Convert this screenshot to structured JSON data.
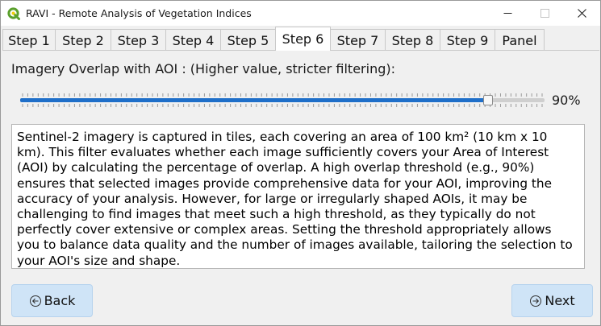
{
  "window": {
    "title": "RAVI - Remote Analysis of Vegetation Indices",
    "brand_color": "#5aa02c"
  },
  "tabs": [
    {
      "label": "Step 1",
      "active": false
    },
    {
      "label": "Step 2",
      "active": false
    },
    {
      "label": "Step 3",
      "active": false
    },
    {
      "label": "Step 4",
      "active": false
    },
    {
      "label": "Step 5",
      "active": false
    },
    {
      "label": "Step 6",
      "active": true
    },
    {
      "label": "Step 7",
      "active": false
    },
    {
      "label": "Step 8",
      "active": false
    },
    {
      "label": "Step 9",
      "active": false
    },
    {
      "label": "Panel",
      "active": false
    }
  ],
  "main": {
    "overlap_label": "Imagery Overlap with AOI : (Higher value, stricter filtering):",
    "slider": {
      "value_percent": 90,
      "value_text": "90%",
      "accent_color": "#1f6fc9"
    },
    "description": "Sentinel-2 imagery is captured in tiles, each covering an area of 100 km² (10 km x 10 km). This filter evaluates whether each image sufficiently covers your Area of Interest (AOI) by calculating the percentage of overlap. A high overlap threshold (e.g., 90%) ensures that selected images provide comprehensive data for your AOI, improving the accuracy of your analysis. However, for large or irregularly shaped AOIs, it may be challenging to find images that meet such a high threshold, as they typically do not perfectly cover extensive or complex areas. Setting the threshold appropriately allows you to balance data quality and the number of images available, tailoring the selection to your AOI's size and shape."
  },
  "footer": {
    "back_label": "Back",
    "next_label": "Next"
  }
}
